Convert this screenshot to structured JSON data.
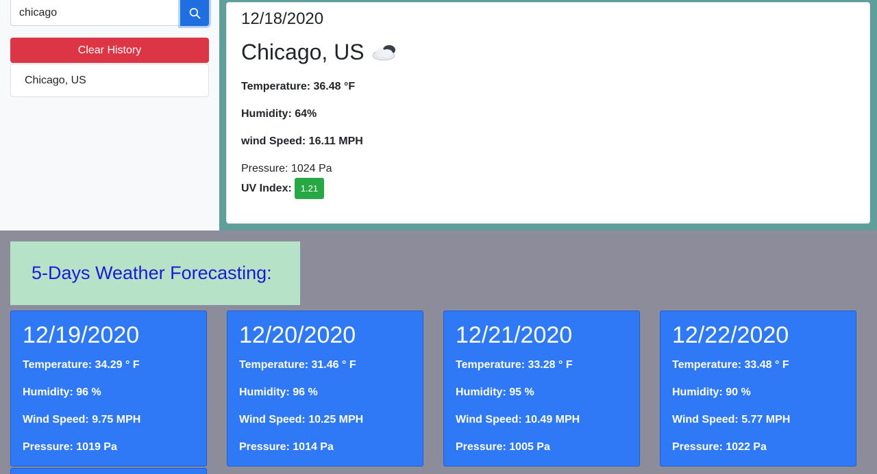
{
  "search": {
    "value": "chicago",
    "button_icon": "search-icon"
  },
  "sidebar": {
    "clear_label": "Clear History",
    "history": [
      "Chicago, US"
    ]
  },
  "current": {
    "date": "12/18/2020",
    "city": "Chicago, US",
    "weather_icon": "cloud-icon",
    "temperature": "Temperature: 36.48 °F",
    "humidity": "Humidity: 64%",
    "wind": "wind Speed: 16.11 MPH",
    "pressure": "Pressure: 1024 Pa",
    "uv_label": "UV Index:",
    "uv_value": "1.21",
    "uv_color": "#28a745"
  },
  "forecast": {
    "title": "5-Days Weather Forecasting:",
    "days": [
      {
        "date": "12/19/2020",
        "temperature": "Temperature: 34.29 ° F",
        "humidity": "Humidity: 96 %",
        "wind": "Wind Speed: 9.75 MPH",
        "pressure": "Pressure: 1019 Pa"
      },
      {
        "date": "12/20/2020",
        "temperature": "Temperature: 31.46 ° F",
        "humidity": "Humidity: 96 %",
        "wind": "Wind Speed: 10.25 MPH",
        "pressure": "Pressure: 1014 Pa"
      },
      {
        "date": "12/21/2020",
        "temperature": "Temperature: 33.28 ° F",
        "humidity": "Humidity: 95 %",
        "wind": "Wind Speed: 10.49 MPH",
        "pressure": "Pressure: 1005 Pa"
      },
      {
        "date": "12/22/2020",
        "temperature": "Temperature: 33.48 ° F",
        "humidity": "Humidity: 90 %",
        "wind": "Wind Speed: 5.77 MPH",
        "pressure": "Pressure: 1022 Pa"
      }
    ]
  },
  "colors": {
    "search_button": "#1f6fe0",
    "clear_button": "#dc3545",
    "forecast_card": "#2f78f6",
    "forecast_title_bg": "#b6e3c8",
    "forecast_title_text": "#1a1ad6",
    "main_bg": "#5f9e9a",
    "page_bg": "#8c8c9b"
  }
}
